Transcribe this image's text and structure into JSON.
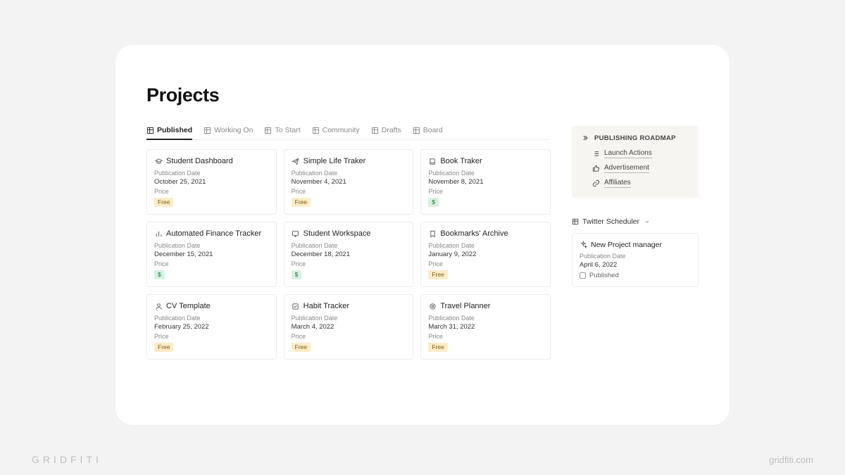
{
  "page_title": "Projects",
  "tabs": [
    {
      "label": "Published",
      "active": true
    },
    {
      "label": "Working On",
      "active": false
    },
    {
      "label": "To Start",
      "active": false
    },
    {
      "label": "Community",
      "active": false
    },
    {
      "label": "Drafts",
      "active": false
    },
    {
      "label": "Board",
      "active": false
    }
  ],
  "fields": {
    "pub_date_label": "Publication Date",
    "price_label": "Price"
  },
  "badges": {
    "free": "Free",
    "dollar": "$"
  },
  "cards": [
    {
      "icon": "grad-cap",
      "title": "Student Dashboard",
      "date": "October 25, 2021",
      "price": "free"
    },
    {
      "icon": "paper-plane",
      "title": "Simple Life Traker",
      "date": "November 4, 2021",
      "price": "free"
    },
    {
      "icon": "book",
      "title": "Book Traker",
      "date": "November 8, 2021",
      "price": "dollar"
    },
    {
      "icon": "bars",
      "title": "Automated Finance Tracker",
      "date": "December 15, 2021",
      "price": "dollar"
    },
    {
      "icon": "monitor",
      "title": "Student Workspace",
      "date": "December 18, 2021",
      "price": "dollar"
    },
    {
      "icon": "bookmark",
      "title": "Bookmarks' Archive",
      "date": "January 9, 2022",
      "price": "free"
    },
    {
      "icon": "person",
      "title": "CV Template",
      "date": "February 25, 2022",
      "price": "free"
    },
    {
      "icon": "check-square",
      "title": "Habit Tracker",
      "date": "March 4, 2022",
      "price": "free"
    },
    {
      "icon": "target",
      "title": "Travel Planner",
      "date": "March 31, 2022",
      "price": "free"
    }
  ],
  "sidebar": {
    "heading": "PUBLISHING ROADMAP",
    "items": [
      {
        "icon": "list",
        "label": "Launch Actions"
      },
      {
        "icon": "thumbs-up",
        "label": "Advertisement"
      },
      {
        "icon": "link",
        "label": "Affiliates"
      }
    ]
  },
  "scheduler": {
    "label": "Twitter Scheduler"
  },
  "side_card": {
    "title": "New Project manager",
    "pub_label": "Publication Date",
    "date": "April 6, 2022",
    "status": "Published"
  },
  "watermark": {
    "left": "GRIDFITI",
    "right": "gridfiti.com"
  }
}
